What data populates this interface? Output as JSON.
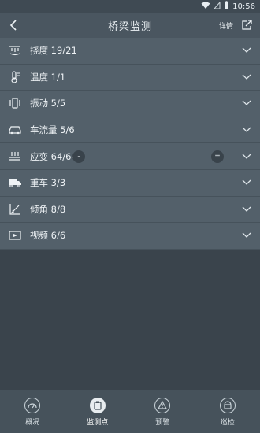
{
  "status_bar": {
    "time": "10:56",
    "signal_icon": "wifi-icon",
    "battery_icon": "battery-icon"
  },
  "header": {
    "title": "桥梁监测",
    "detail_label": "详情",
    "back_icon": "chevron-left-icon",
    "share_icon": "share-icon"
  },
  "sections": [
    {
      "label": "挠度 19/21",
      "icon": "deflection-icon"
    },
    {
      "label": "温度 1/1",
      "icon": "thermometer-icon"
    },
    {
      "label": "振动 5/5",
      "icon": "vibration-icon"
    },
    {
      "label": "车流量 5/6",
      "icon": "car-icon"
    },
    {
      "label": "应变 64/64",
      "icon": "strain-icon"
    },
    {
      "label": "重车 3/3",
      "icon": "truck-icon"
    },
    {
      "label": "倾角 8/8",
      "icon": "tilt-icon"
    },
    {
      "label": "视频 6/6",
      "icon": "video-icon"
    }
  ],
  "overlay_buttons": {
    "minus_label": "-",
    "equals_label": "="
  },
  "tabs": [
    {
      "label": "概况",
      "icon": "overview-icon",
      "active": false
    },
    {
      "label": "监测点",
      "icon": "monitor-point-icon",
      "active": true
    },
    {
      "label": "预警",
      "icon": "warning-icon",
      "active": false
    },
    {
      "label": "巡检",
      "icon": "inspection-icon",
      "active": false
    }
  ],
  "colors": {
    "header_bg": "#4a5660",
    "row_bg": "#53606a",
    "empty_bg": "#3a444c",
    "tabbar_bg": "#46525b",
    "text": "#eef2f5"
  }
}
